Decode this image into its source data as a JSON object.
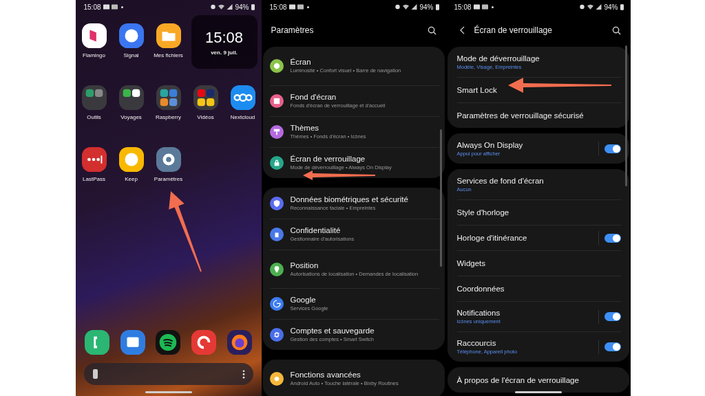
{
  "home_screen": {
    "status_bar": {
      "time": "15:08",
      "battery": "94%"
    },
    "apps": [
      {
        "label": "Flamingo"
      },
      {
        "label": "Signal"
      },
      {
        "label": "Mes fichiers"
      },
      {
        "label": "Outils"
      },
      {
        "label": "Voyages"
      },
      {
        "label": "Raspberry"
      },
      {
        "label": "Vidéos"
      },
      {
        "label": "Nextcloud"
      },
      {
        "label": "LastPass"
      },
      {
        "label": "Keep"
      },
      {
        "label": "Paramètres"
      }
    ],
    "clock_widget": {
      "time": "15:08",
      "date": "ven. 9 juil."
    }
  },
  "settings": {
    "status_bar": {
      "time": "15:08",
      "battery": "94%"
    },
    "title": "Paramètres",
    "groups": [
      [
        {
          "title": "Écran",
          "subtitle": "Luminosité  •  Confort visuel  •  Barre de navigation",
          "color": "#8bc34a"
        },
        {
          "title": "Fond d'écran",
          "subtitle": "Fonds d'écran de verrouillage et d'accueil",
          "color": "#e8608a"
        },
        {
          "title": "Thèmes",
          "subtitle": "Thèmes  •  Fonds d'écran  •  Icônes",
          "color": "#b56be0"
        },
        {
          "title": "Écran de verrouillage",
          "subtitle": "Mode de déverrouillage  •  Always On Display",
          "color": "#26a68a"
        }
      ],
      [
        {
          "title": "Données biométriques et sécurité",
          "subtitle": "Reconnaissance faciale  •  Empreintes",
          "color": "#5b6cf0"
        },
        {
          "title": "Confidentialité",
          "subtitle": "Gestionnaire d'autorisations",
          "color": "#4a78e8"
        },
        {
          "title": "Position",
          "subtitle": "Autorisations de localisation  •  Demandes de localisation",
          "color": "#4caf50"
        },
        {
          "title": "Google",
          "subtitle": "Services Google",
          "color": "#3c7cf0"
        },
        {
          "title": "Comptes et sauvegarde",
          "subtitle": "Gestion des comptes  •  Smart Switch",
          "color": "#4a6ee8"
        }
      ],
      [
        {
          "title": "Fonctions avancées",
          "subtitle": "Android Auto  •  Touche latérale  •  Bixby Routines",
          "color": "#f5b73b"
        }
      ]
    ]
  },
  "lock_screen": {
    "status_bar": {
      "time": "15:08",
      "battery": "94%"
    },
    "title": "Écran de verrouillage",
    "groups": [
      [
        {
          "title": "Mode de déverrouillage",
          "subtitle": "Modèle, Visage, Empreintes"
        },
        {
          "title": "Smart Lock"
        },
        {
          "title": "Paramètres de verrouillage sécurisé"
        }
      ],
      [
        {
          "title": "Always On Display",
          "subtitle": "Appui pour afficher",
          "on": true
        }
      ],
      [
        {
          "title": "Services de fond d'écran",
          "subtitle": "Aucun"
        },
        {
          "title": "Style d'horloge"
        },
        {
          "title": "Horloge d'itinérance",
          "on": true
        },
        {
          "title": "Widgets"
        },
        {
          "title": "Coordonnées"
        },
        {
          "title": "Notifications",
          "subtitle": "Icônes uniquement",
          "on": true
        },
        {
          "title": "Raccourcis",
          "subtitle": "Téléphone, Appareil photo",
          "on": true
        }
      ],
      [
        {
          "title": "À propos de l'écran de verrouillage"
        }
      ]
    ]
  }
}
